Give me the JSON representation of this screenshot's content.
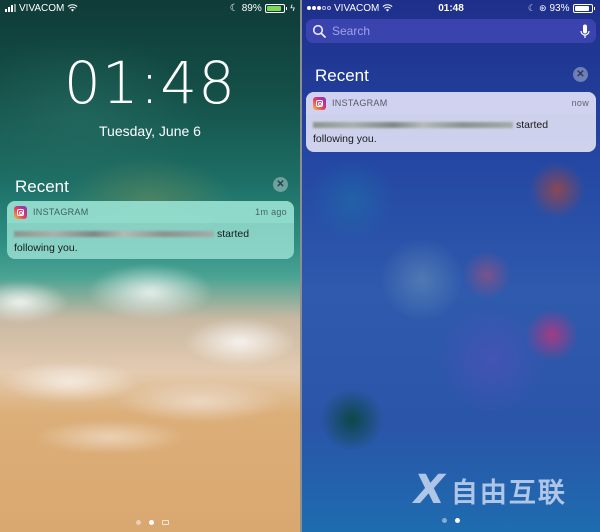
{
  "left_screen": {
    "status_bar": {
      "carrier": "VIVACOM",
      "battery_percent": "89%",
      "battery_level": 0.89,
      "battery_color": "#7ed957",
      "charging": true,
      "icons": [
        "signal-bars-icon",
        "wifi-icon",
        "moon-icon",
        "battery-icon",
        "bolt-icon"
      ]
    },
    "clock": "01:48",
    "date": "Tuesday, June 6",
    "recent": {
      "title": "Recent",
      "clear_label": "✕"
    },
    "notification": {
      "app": "INSTAGRAM",
      "time": "1m ago",
      "message_suffix": "started",
      "message_line2": "following you."
    },
    "page_dots": {
      "count": 2,
      "active": 1,
      "camera_indicator": true
    }
  },
  "right_screen": {
    "status_bar": {
      "carrier": "VIVACOM",
      "time": "01:48",
      "battery_percent": "93%",
      "battery_level": 0.93,
      "battery_color": "#ffffff",
      "signal_dots_filled": 3,
      "signal_dots_total": 5,
      "icons": [
        "signal-dots-icon",
        "wifi-icon",
        "moon-icon",
        "orientation-lock-icon",
        "battery-icon"
      ]
    },
    "search": {
      "placeholder": "Search"
    },
    "recent": {
      "title": "Recent",
      "clear_label": "✕"
    },
    "notification": {
      "app": "INSTAGRAM",
      "time": "now",
      "message_suffix": "started",
      "message_line2": "following you."
    },
    "page_dots": {
      "count": 2,
      "active": 1
    }
  },
  "watermark": {
    "logo": "X",
    "text": "自由互联"
  }
}
